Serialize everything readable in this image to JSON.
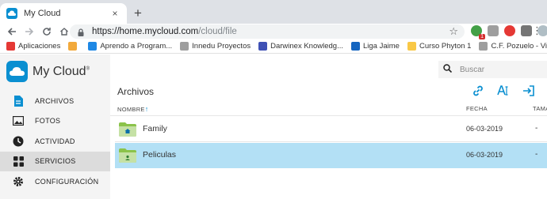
{
  "browser": {
    "tab_title": "My Cloud",
    "tab_close": "×",
    "new_tab": "+",
    "url_host": "https://home.mycloud.com",
    "url_path": "/cloud/file",
    "ext_badge": "1",
    "bookmarks": [
      {
        "label": "Aplicaciones",
        "icon": "apps-grid-icon",
        "color": "#e53935"
      },
      {
        "label": "",
        "icon": "bookmark-b-icon",
        "color": "#f2a93b"
      },
      {
        "label": "Aprendo a Program...",
        "icon": "amazon-a-icon",
        "color": "#1e88e5"
      },
      {
        "label": "Innedu Proyectos",
        "icon": "page-icon",
        "color": "#9e9e9e"
      },
      {
        "label": "Darwinex Knowledg...",
        "icon": "owl-icon",
        "color": "#3f51b5"
      },
      {
        "label": "Liga Jaime",
        "icon": "fire-icon",
        "color": "#1565c0"
      },
      {
        "label": "Curso Phyton 1",
        "icon": "folder-icon",
        "color": "#f9c846"
      },
      {
        "label": "C.F. Pozuelo - Visua...",
        "icon": "page-icon",
        "color": "#9e9e9e"
      }
    ]
  },
  "app": {
    "name": "My Cloud",
    "trademark": "®",
    "search_placeholder": "Buscar",
    "accent": "#0a8fd1",
    "nav": [
      {
        "label": "ARCHIVOS",
        "icon": "file-icon",
        "active": false
      },
      {
        "label": "FOTOS",
        "icon": "photo-icon",
        "active": false
      },
      {
        "label": "ACTIVIDAD",
        "icon": "clock-icon",
        "active": false
      },
      {
        "label": "SERVICIOS",
        "icon": "grid-icon",
        "active": true
      },
      {
        "label": "CONFIGURACIÓN",
        "icon": "gear-icon",
        "active": false
      }
    ]
  },
  "main": {
    "title": "Archivos",
    "columns": {
      "name": "NOMBRE",
      "sort_arrow": "↑",
      "date": "FECHA",
      "size": "TAMA"
    },
    "rows": [
      {
        "name": "Family",
        "date": "06-03-2019",
        "size": "-",
        "icon": "home-folder-icon",
        "selected": false
      },
      {
        "name": "Peliculas",
        "date": "06-03-2019",
        "size": "-",
        "icon": "shared-folder-icon",
        "selected": true
      }
    ]
  }
}
